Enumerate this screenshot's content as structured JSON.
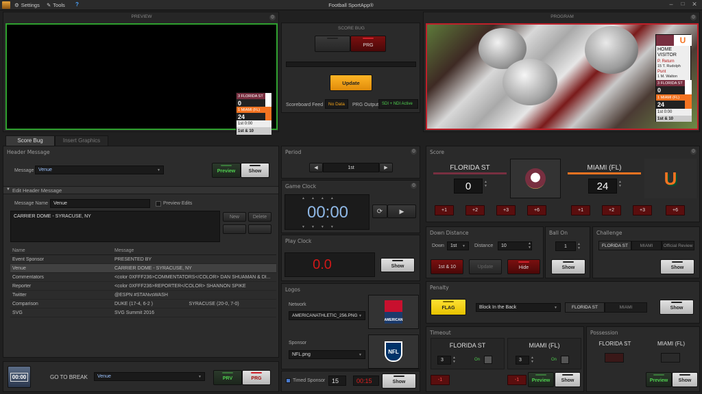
{
  "menu": {
    "settings": "Settings",
    "tools": "Tools",
    "help": "?",
    "title": "Football SportApp®"
  },
  "preview": {
    "title": "PREVIEW"
  },
  "program": {
    "title": "PROGRAM"
  },
  "bug_mini": {
    "team1": "3 FLORIDA ST",
    "score1": "0",
    "team2": "1 MIAMI (FL)",
    "score2": "24",
    "clock": "1st   0:00",
    "down": "1st & 10"
  },
  "program_overlay": {
    "line1": "HOME",
    "line2": "VISITOR",
    "play1": "P. Return",
    "player1": "15 T. Rudolph",
    "play2": "Punt",
    "player2": "1 M. Walton",
    "team1": "3 FLORIDA ST",
    "score1": "0",
    "team2": "1 MIAMI (FL)",
    "score2": "24",
    "clock": "1st   0:00",
    "down": "1st & 10"
  },
  "scorebug": {
    "title": "SCORE BUG",
    "prg": "PRG",
    "update": "Update",
    "feed_label": "Scoreboard Feed",
    "feed_value": "No Data",
    "output_label": "PRG Output",
    "output_value": "SDI + NDI Active"
  },
  "tabs": {
    "score_bug": "Score Bug",
    "insert_graphics": "Insert Graphics"
  },
  "header_message": {
    "title": "Header Message",
    "label": "Message",
    "value": "Venue",
    "preview": "Preview",
    "show": "Show"
  },
  "edit_header": {
    "title": "Edit Header Message",
    "name_label": "Message Name",
    "name_value": "Venue",
    "preview_edits": "Preview Edits",
    "text": "CARRIER DOME - SYRACUSE, NY",
    "new": "New",
    "delete": "Delete"
  },
  "messages_table": {
    "col_name": "Name",
    "col_message": "Message",
    "rows": [
      {
        "name": "Event Sponsor",
        "message": "PRESENTED BY"
      },
      {
        "name": "Venue",
        "message": "CARRIER DOME - SYRACUSE, NY"
      },
      {
        "name": "Commentators",
        "message": "<color 0XFFF236>COMMENTATORS</COLOR> DAN SHUAMAN & DI..."
      },
      {
        "name": "Reporter",
        "message": "<color 0XFFF236>REPORTER</COLOR> SHANNON SPIKE"
      },
      {
        "name": "Twitter",
        "message": "@ESPN   #STANvsWASH"
      },
      {
        "name": "Comparison",
        "message": "DUKE (17-4, 6-2 )                           SYRACUSE (20-0, 7-0)"
      },
      {
        "name": "SVG",
        "message": "SVG Summit 2016"
      }
    ]
  },
  "go_to_break": {
    "label": "GO TO BREAK",
    "value": "Venue",
    "prv": "PRV",
    "prg": "PRG",
    "icon_text": "00:00"
  },
  "period": {
    "title": "Period",
    "value": "1st"
  },
  "game_clock": {
    "title": "Game Clock",
    "value": "00:00"
  },
  "play_clock": {
    "title": "Play Clock",
    "value": "0.0",
    "show": "Show"
  },
  "logos": {
    "title": "Logos",
    "network_label": "Network",
    "network_value": "AMERICANATHLETIC_256.PNG",
    "sponsor_label": "Sponsor",
    "sponsor_value": "NFL.png",
    "network_logo_text": "AMERICAN",
    "sponsor_logo_text": "NFL"
  },
  "timed_sponsor": {
    "label": "Timed Sponsor",
    "seconds": "15",
    "countdown": "00:15",
    "show": "Show"
  },
  "score": {
    "title": "Score",
    "home": {
      "name": "FLORIDA ST",
      "score": "0"
    },
    "away": {
      "name": "MIAMI (FL)",
      "score": "24"
    },
    "increments": [
      "+1",
      "+2",
      "+3",
      "+6"
    ]
  },
  "down_distance": {
    "title": "Down Distance",
    "down_label": "Down",
    "down_value": "1st",
    "distance_label": "Distance",
    "distance_value": "10",
    "btn_1st10": "1st & 10",
    "btn_update": "Update",
    "btn_hide": "Hide"
  },
  "ball_on": {
    "title": "Ball On",
    "value": "1",
    "show": "Show"
  },
  "challenge": {
    "title": "Challenge",
    "opt1": "FLORIDA ST",
    "opt2": "MIAMI",
    "opt3": "Official Review",
    "show": "Show"
  },
  "penalty": {
    "title": "Penalty",
    "flag": "FLAG",
    "value": "Block In the Back",
    "opt1": "FLORIDA ST",
    "opt2": "MIAMI",
    "show": "Show"
  },
  "timeout": {
    "title": "Timeout",
    "home": "FLORIDA ST",
    "away": "MIAMI (FL)",
    "home_value": "3",
    "away_value": "3",
    "on": "On",
    "minus": "-1",
    "preview": "Preview",
    "show": "Show"
  },
  "possession": {
    "title": "Possession",
    "home": "FLORIDA ST",
    "away": "MIAMI (FL)",
    "preview": "Preview",
    "show": "Show"
  },
  "colors": {
    "fsu": "#782f40",
    "miami": "#f47321",
    "accent_orange": "#f5a418",
    "red_btn": "#5a0e0e"
  }
}
